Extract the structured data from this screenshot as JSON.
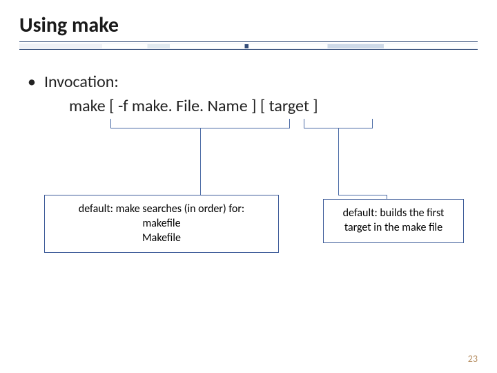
{
  "title": "Using make",
  "bullet_label": "Invocation:",
  "command_line": "make  [ -f  make. File. Name ]  [ target ]",
  "box_left": {
    "line1": "default: make searches (in order) for:",
    "line2": "makefile",
    "line3": "Makefile"
  },
  "box_right": {
    "line1": "default: builds the first",
    "line2": "target in the make file"
  },
  "slide_number": "23"
}
